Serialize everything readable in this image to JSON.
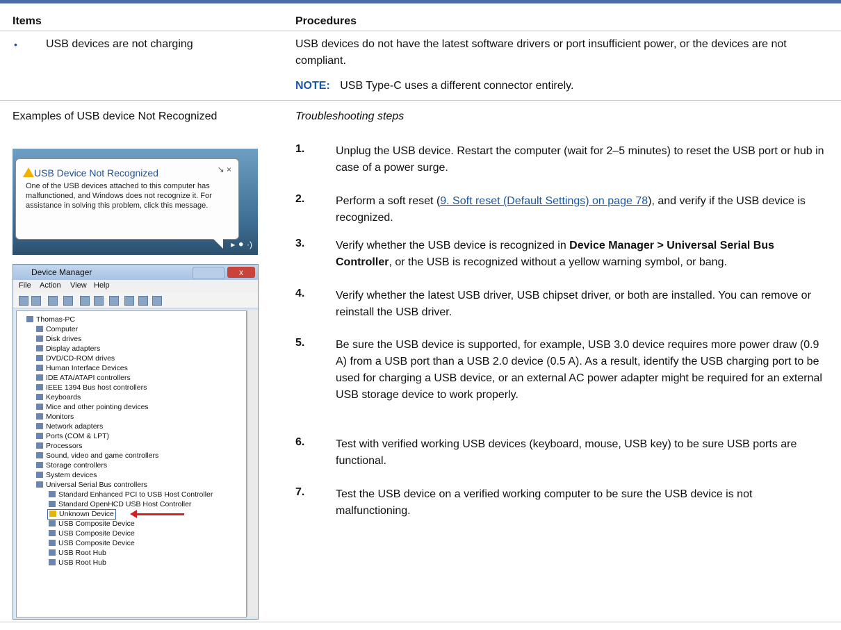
{
  "header": {
    "items_label": "Items",
    "procedures_label": "Procedures"
  },
  "row1": {
    "bullet": "•",
    "item": "USB devices are not charging",
    "procedure": "USB devices do not have the latest software drivers or port insufficient power, or the devices are not compliant.",
    "note_label": "NOTE:",
    "note_text": "USB Type-C uses a different connector entirely."
  },
  "row2": {
    "item": "Examples of USB device Not Recognized",
    "subtitle": "Troubleshooting steps"
  },
  "balloon": {
    "title": "USB Device Not Recognized",
    "body": "One of the USB devices attached to this computer has malfunctioned, and Windows does not recognize it. For assistance in solving this problem, click this message.",
    "controls": "↘ ×",
    "tray": "▸ ⚫ ·)"
  },
  "device_manager": {
    "title": "Device Manager",
    "close": "x",
    "menu": [
      "File",
      "Action",
      "View",
      "Help"
    ],
    "tree": [
      "Thomas-PC",
      "Computer",
      "Disk drives",
      "Display adapters",
      "DVD/CD-ROM drives",
      "Human Interface Devices",
      "IDE ATA/ATAPI controllers",
      "IEEE 1394 Bus host controllers",
      "Keyboards",
      "Mice and other pointing devices",
      "Monitors",
      "Network adapters",
      "Ports (COM & LPT)",
      "Processors",
      "Sound, video and game controllers",
      "Storage controllers",
      "System devices",
      "Universal Serial Bus controllers",
      "Standard Enhanced PCI to USB Host Controller",
      "Standard OpenHCD USB Host Controller",
      "Unknown Device",
      "USB Composite Device",
      "USB Composite Device",
      "USB Composite Device",
      "USB Root Hub",
      "USB Root Hub"
    ]
  },
  "steps": [
    {
      "num": "1.",
      "text": "Unplug the USB device. Restart the computer (wait for 2–5 minutes) to reset the USB port or hub in case of a power surge."
    },
    {
      "num": "2.",
      "pre": "Perform a soft reset (",
      "link": "9. Soft reset (Default Settings) on page 78",
      "post": "), and verify if the USB device is recognized."
    },
    {
      "num": "3.",
      "pre": "Verify whether the USB device is recognized in ",
      "bold": "Device Manager > Universal Serial Bus Controller",
      "post": ", or the USB is recognized without a yellow warning symbol, or bang."
    },
    {
      "num": "4.",
      "text": "Verify whether the latest USB driver, USB chipset driver, or both are installed. You can remove or reinstall the USB driver."
    },
    {
      "num": "5.",
      "text": "Be sure the USB device is supported, for example, USB 3.0 device requires more power draw (0.9 A) from a USB port than a USB 2.0 device (0.5 A). As a result, identify the USB charging port to be used for charging a USB device, or an external AC power adapter might be required for an external USB storage device to work properly."
    },
    {
      "num": "6.",
      "text": "Test with verified working USB devices (keyboard, mouse, USB key) to be sure USB ports are functional."
    },
    {
      "num": "7.",
      "text": "Test the USB device on a verified working computer to be sure the USB device is not malfunctioning."
    }
  ]
}
